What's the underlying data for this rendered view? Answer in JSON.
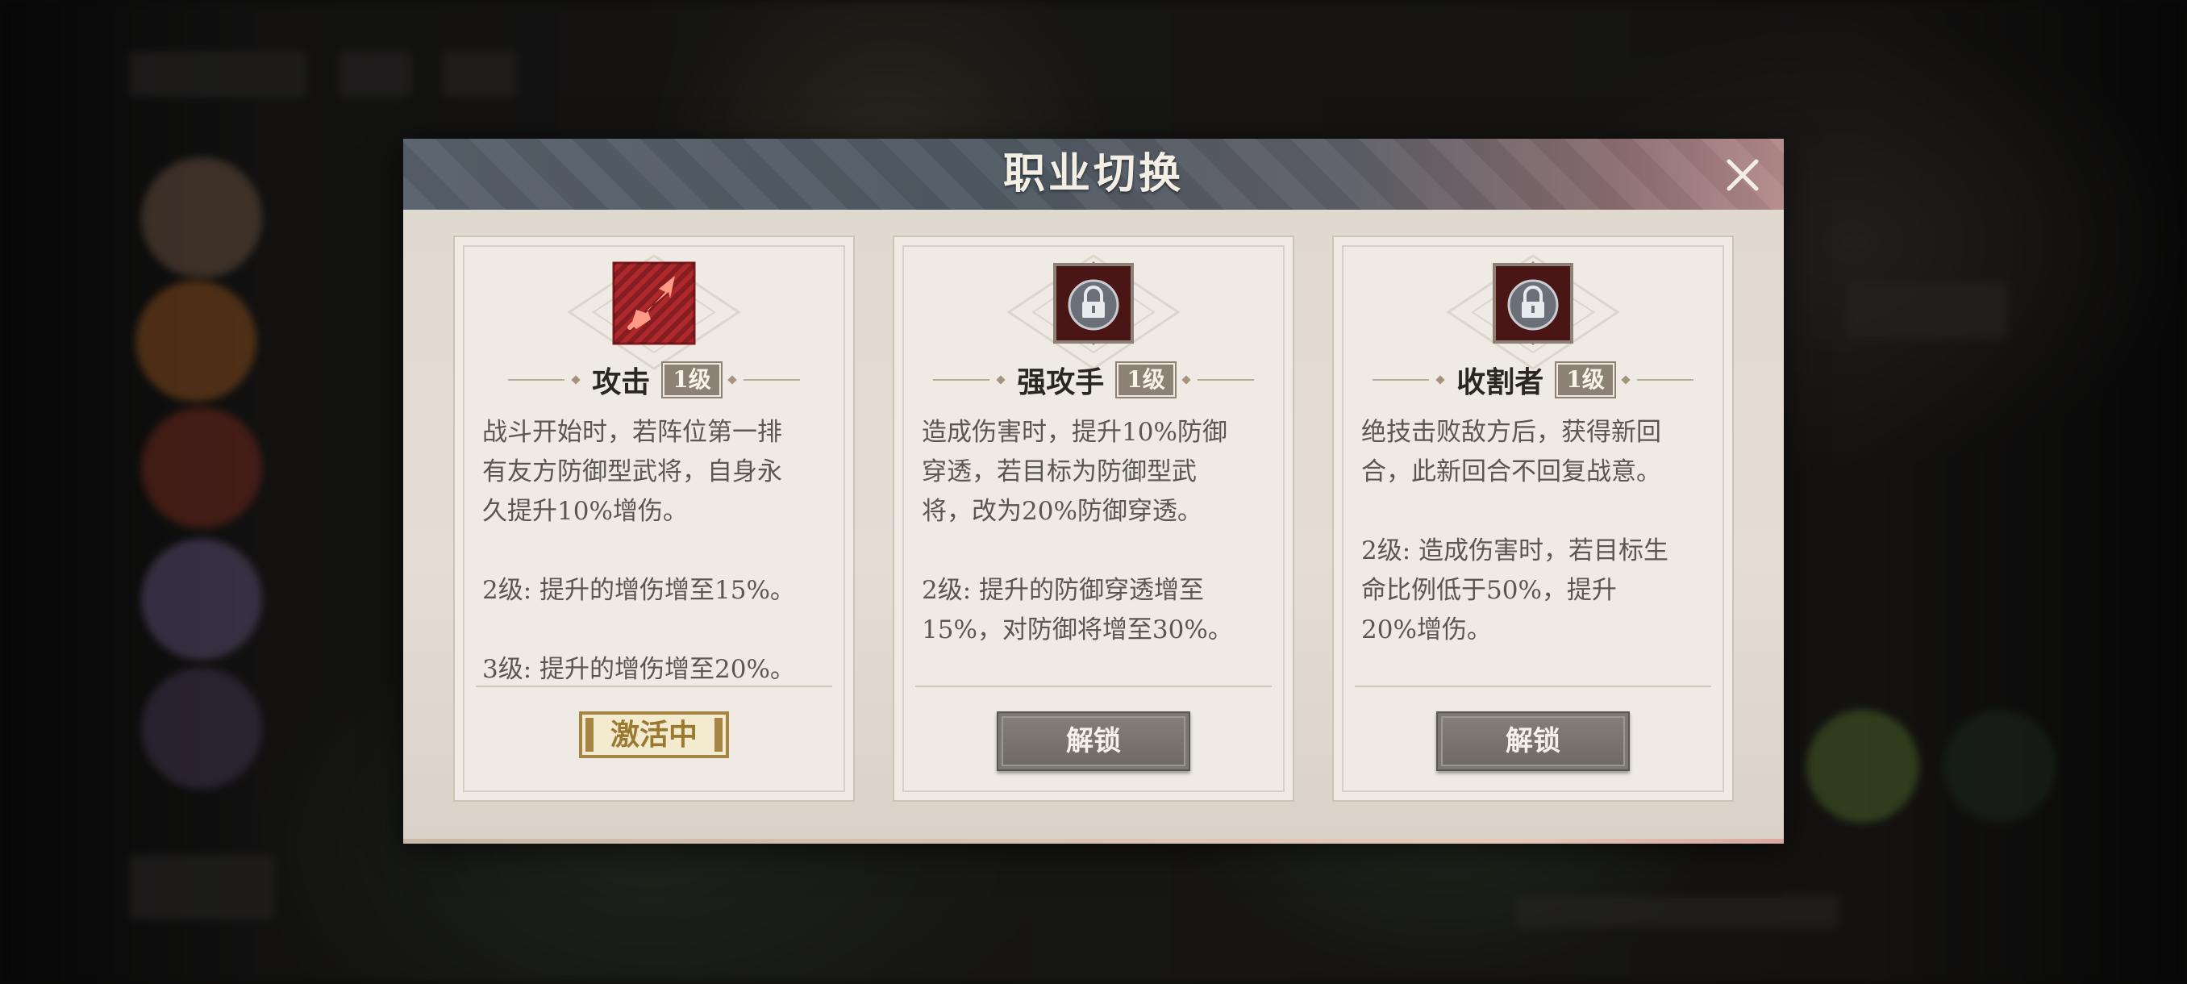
{
  "dialog": {
    "title": "职业切换",
    "close_icon": "close-icon"
  },
  "cards": [
    {
      "icon": "sword-slash-icon",
      "name": "攻击",
      "level": "1级",
      "description": "战斗开始时，若阵位第一排\n有友方防御型武将，自身永\n久提升10%增伤。\n\n2级: 提升的增伤增至15%。\n\n3级: 提升的增伤增至20%。",
      "status_label": "激活中",
      "state": "active"
    },
    {
      "icon": "lock-icon",
      "name": "强攻手",
      "level": "1级",
      "description": "造成伤害时，提升10%防御\n穿透，若目标为防御型武\n将，改为20%防御穿透。\n\n2级: 提升的防御穿透增至\n15%，对防御将增至30%。",
      "button_label": "解锁",
      "state": "locked"
    },
    {
      "icon": "lock-icon",
      "name": "收割者",
      "level": "1级",
      "description": "绝技击败敌方后，获得新回\n合，此新回合不回复战意。\n\n2级: 造成伤害时，若目标生\n命比例低于50%，提升\n20%增伤。",
      "button_label": "解锁",
      "state": "locked"
    }
  ],
  "colors": {
    "header": "#56606a",
    "card_bg": "#efebe4",
    "active_gold": "#a58543",
    "icon_red": "#b0282c",
    "locked_icon_bg": "#4a1515"
  }
}
